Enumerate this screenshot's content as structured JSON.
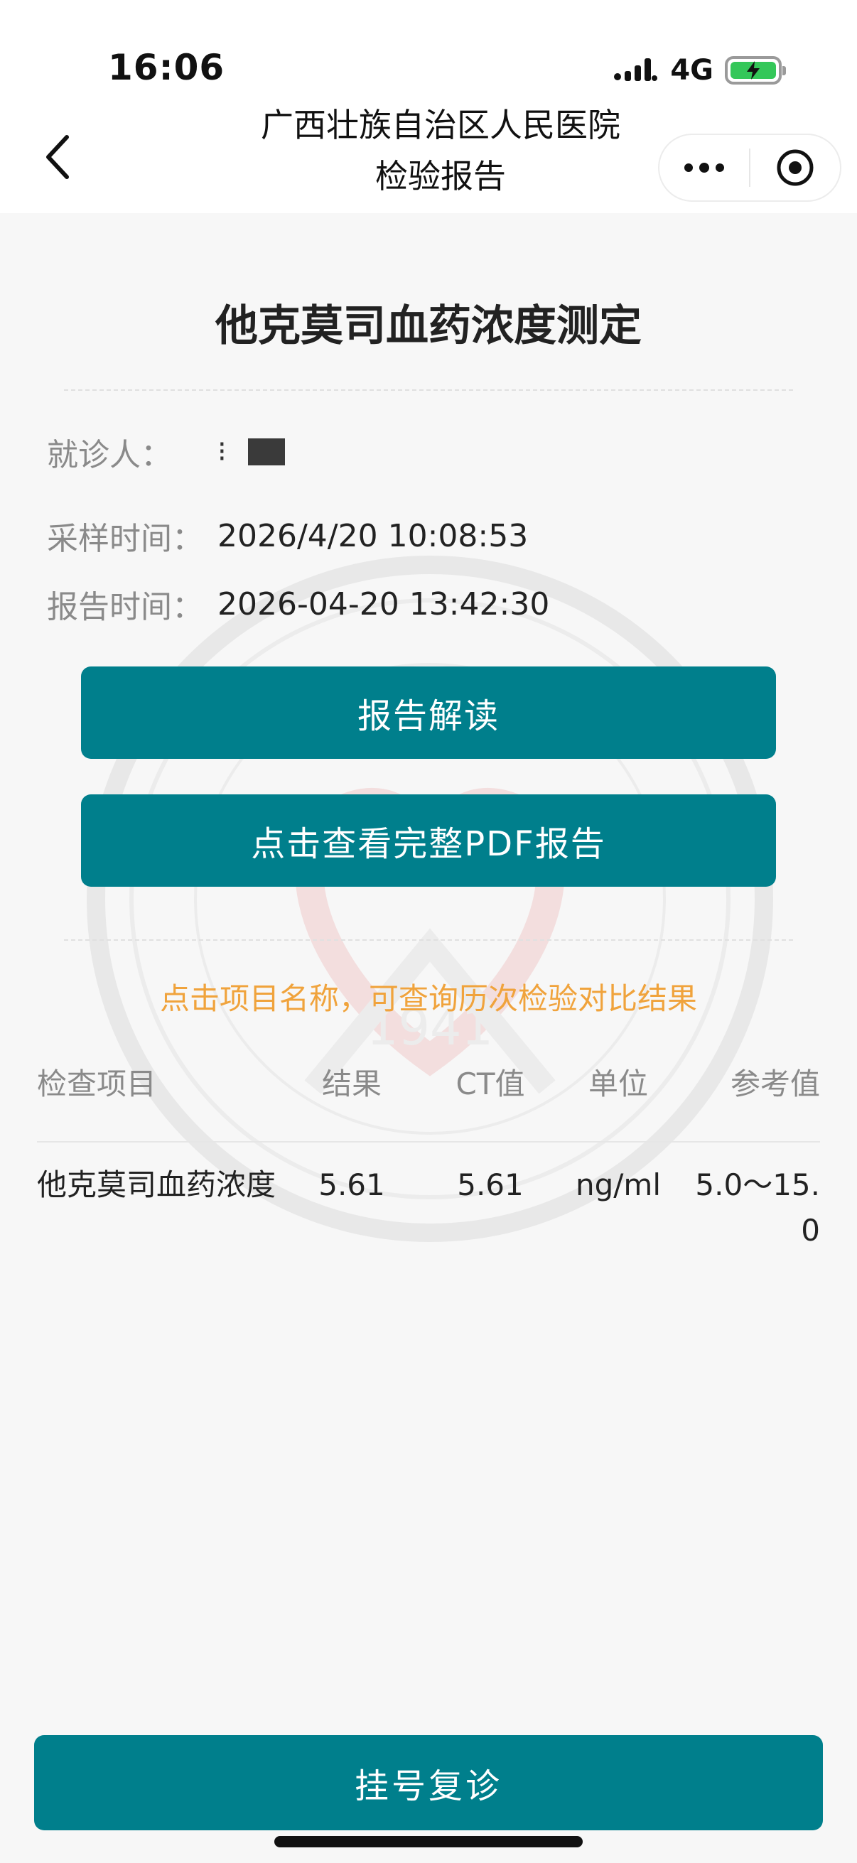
{
  "status_bar": {
    "time": "16:06",
    "network": "4G"
  },
  "nav": {
    "title_line1": "广西壮族自治区人民医院",
    "title_line2": "检验报告"
  },
  "report": {
    "title": "他克莫司血药浓度测定",
    "patient_label": "就诊人：",
    "sample_time_label": "采样时间：",
    "sample_time": "2026/4/20 10:08:53",
    "report_time_label": "报告时间：",
    "report_time": "2026-04-20 13:42:30"
  },
  "buttons": {
    "interpret": "报告解读",
    "view_pdf": "点击查看完整PDF报告",
    "follow_up": "挂号复诊"
  },
  "hint": "点击项目名称，可查询历次检验对比结果",
  "table": {
    "headers": {
      "item": "检查项目",
      "result": "结果",
      "ct": "CT值",
      "unit": "单位",
      "reference": "参考值"
    },
    "rows": [
      {
        "item": "他克莫司血药浓度",
        "result": "5.61",
        "ct": "5.61",
        "unit": "ng/ml",
        "reference": "5.0～15.0"
      }
    ]
  },
  "watermark": {
    "year": "1941"
  },
  "colors": {
    "primary": "#007f8c",
    "hint": "#f0a33c",
    "label": "#8a8a8a",
    "battery": "#34c759"
  }
}
